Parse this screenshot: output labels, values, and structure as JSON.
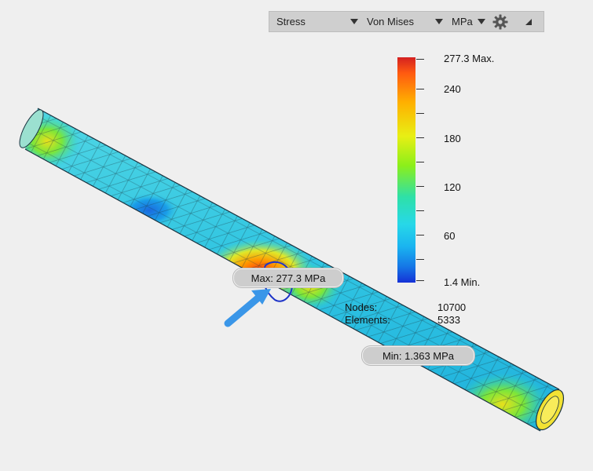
{
  "toolbar": {
    "result_type": "Stress",
    "criterion": "Von Mises",
    "unit": "MPa"
  },
  "legend": {
    "max_label": "277.3 Max.",
    "ticks": [
      "240",
      "180",
      "120",
      "60"
    ],
    "min_label": "1.4 Min."
  },
  "callouts": {
    "max": "Max: 277.3 MPa",
    "min": "Min: 1.363 MPa"
  },
  "mesh_stats": {
    "nodes_label": "Nodes:",
    "nodes_value": "10700",
    "elements_label": "Elements:",
    "elements_value": "5333"
  },
  "colors": {
    "max_color": "#d42020",
    "min_color": "#1531d6",
    "load_arrow": "#3a96e8",
    "panel": "#cfcfcf"
  },
  "icons": [
    "settings-gear-icon",
    "collapse-triangle-icon",
    "load-arrow-icon"
  ]
}
